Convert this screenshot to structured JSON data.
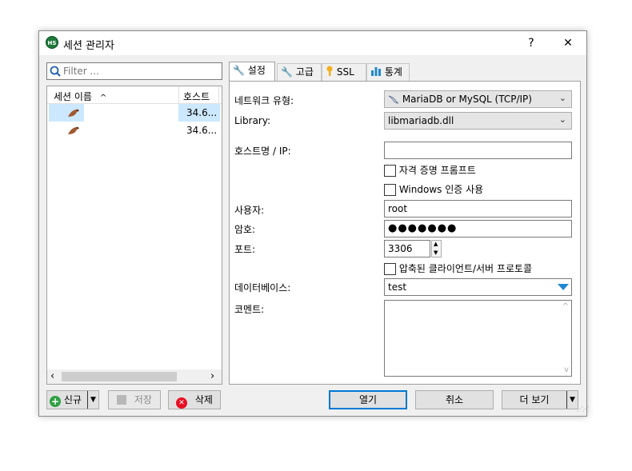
{
  "window": {
    "title": "세션 관리자",
    "help_label": "?",
    "close_label": "✕",
    "app_icon_text": "HS"
  },
  "sidebar": {
    "filter_placeholder": "Filter ...",
    "columns": {
      "name": "세션 이름",
      "host": "호스트"
    },
    "rows": [
      {
        "host": "34.6..."
      },
      {
        "host": "34.6..."
      }
    ],
    "scroll_left": "‹",
    "scroll_right": "›"
  },
  "tabs": [
    {
      "label": "설정"
    },
    {
      "label": "고급"
    },
    {
      "label": "SSL"
    },
    {
      "label": "통계"
    }
  ],
  "form": {
    "network_type_label": "네트워크 유형:",
    "network_type_value": "MariaDB or MySQL (TCP/IP)",
    "library_label": "Library:",
    "library_value": "libmariadb.dll",
    "host_label": "호스트명 / IP:",
    "host_value": "",
    "prompt_credentials_label": "자격 증명 프롬프트",
    "windows_auth_label": "Windows 인증 사용",
    "user_label": "사용자:",
    "user_value": "root",
    "password_label": "암호:",
    "password_value": "●●●●●●●",
    "port_label": "포트:",
    "port_value": "3306",
    "compressed_label": "압축된 클라이언트/서버 프로토콜",
    "database_label": "데이터베이스:",
    "database_value": "test",
    "comment_label": "코멘트:",
    "comment_value": ""
  },
  "buttons": {
    "new": "신규",
    "save": "저장",
    "delete": "삭제",
    "open": "열기",
    "cancel": "취소",
    "more": "더 보기"
  },
  "colors": {
    "selection": "#cce8ff",
    "accent": "#0078d7",
    "new_green": "#2ea043",
    "delete_red": "#e81123"
  }
}
